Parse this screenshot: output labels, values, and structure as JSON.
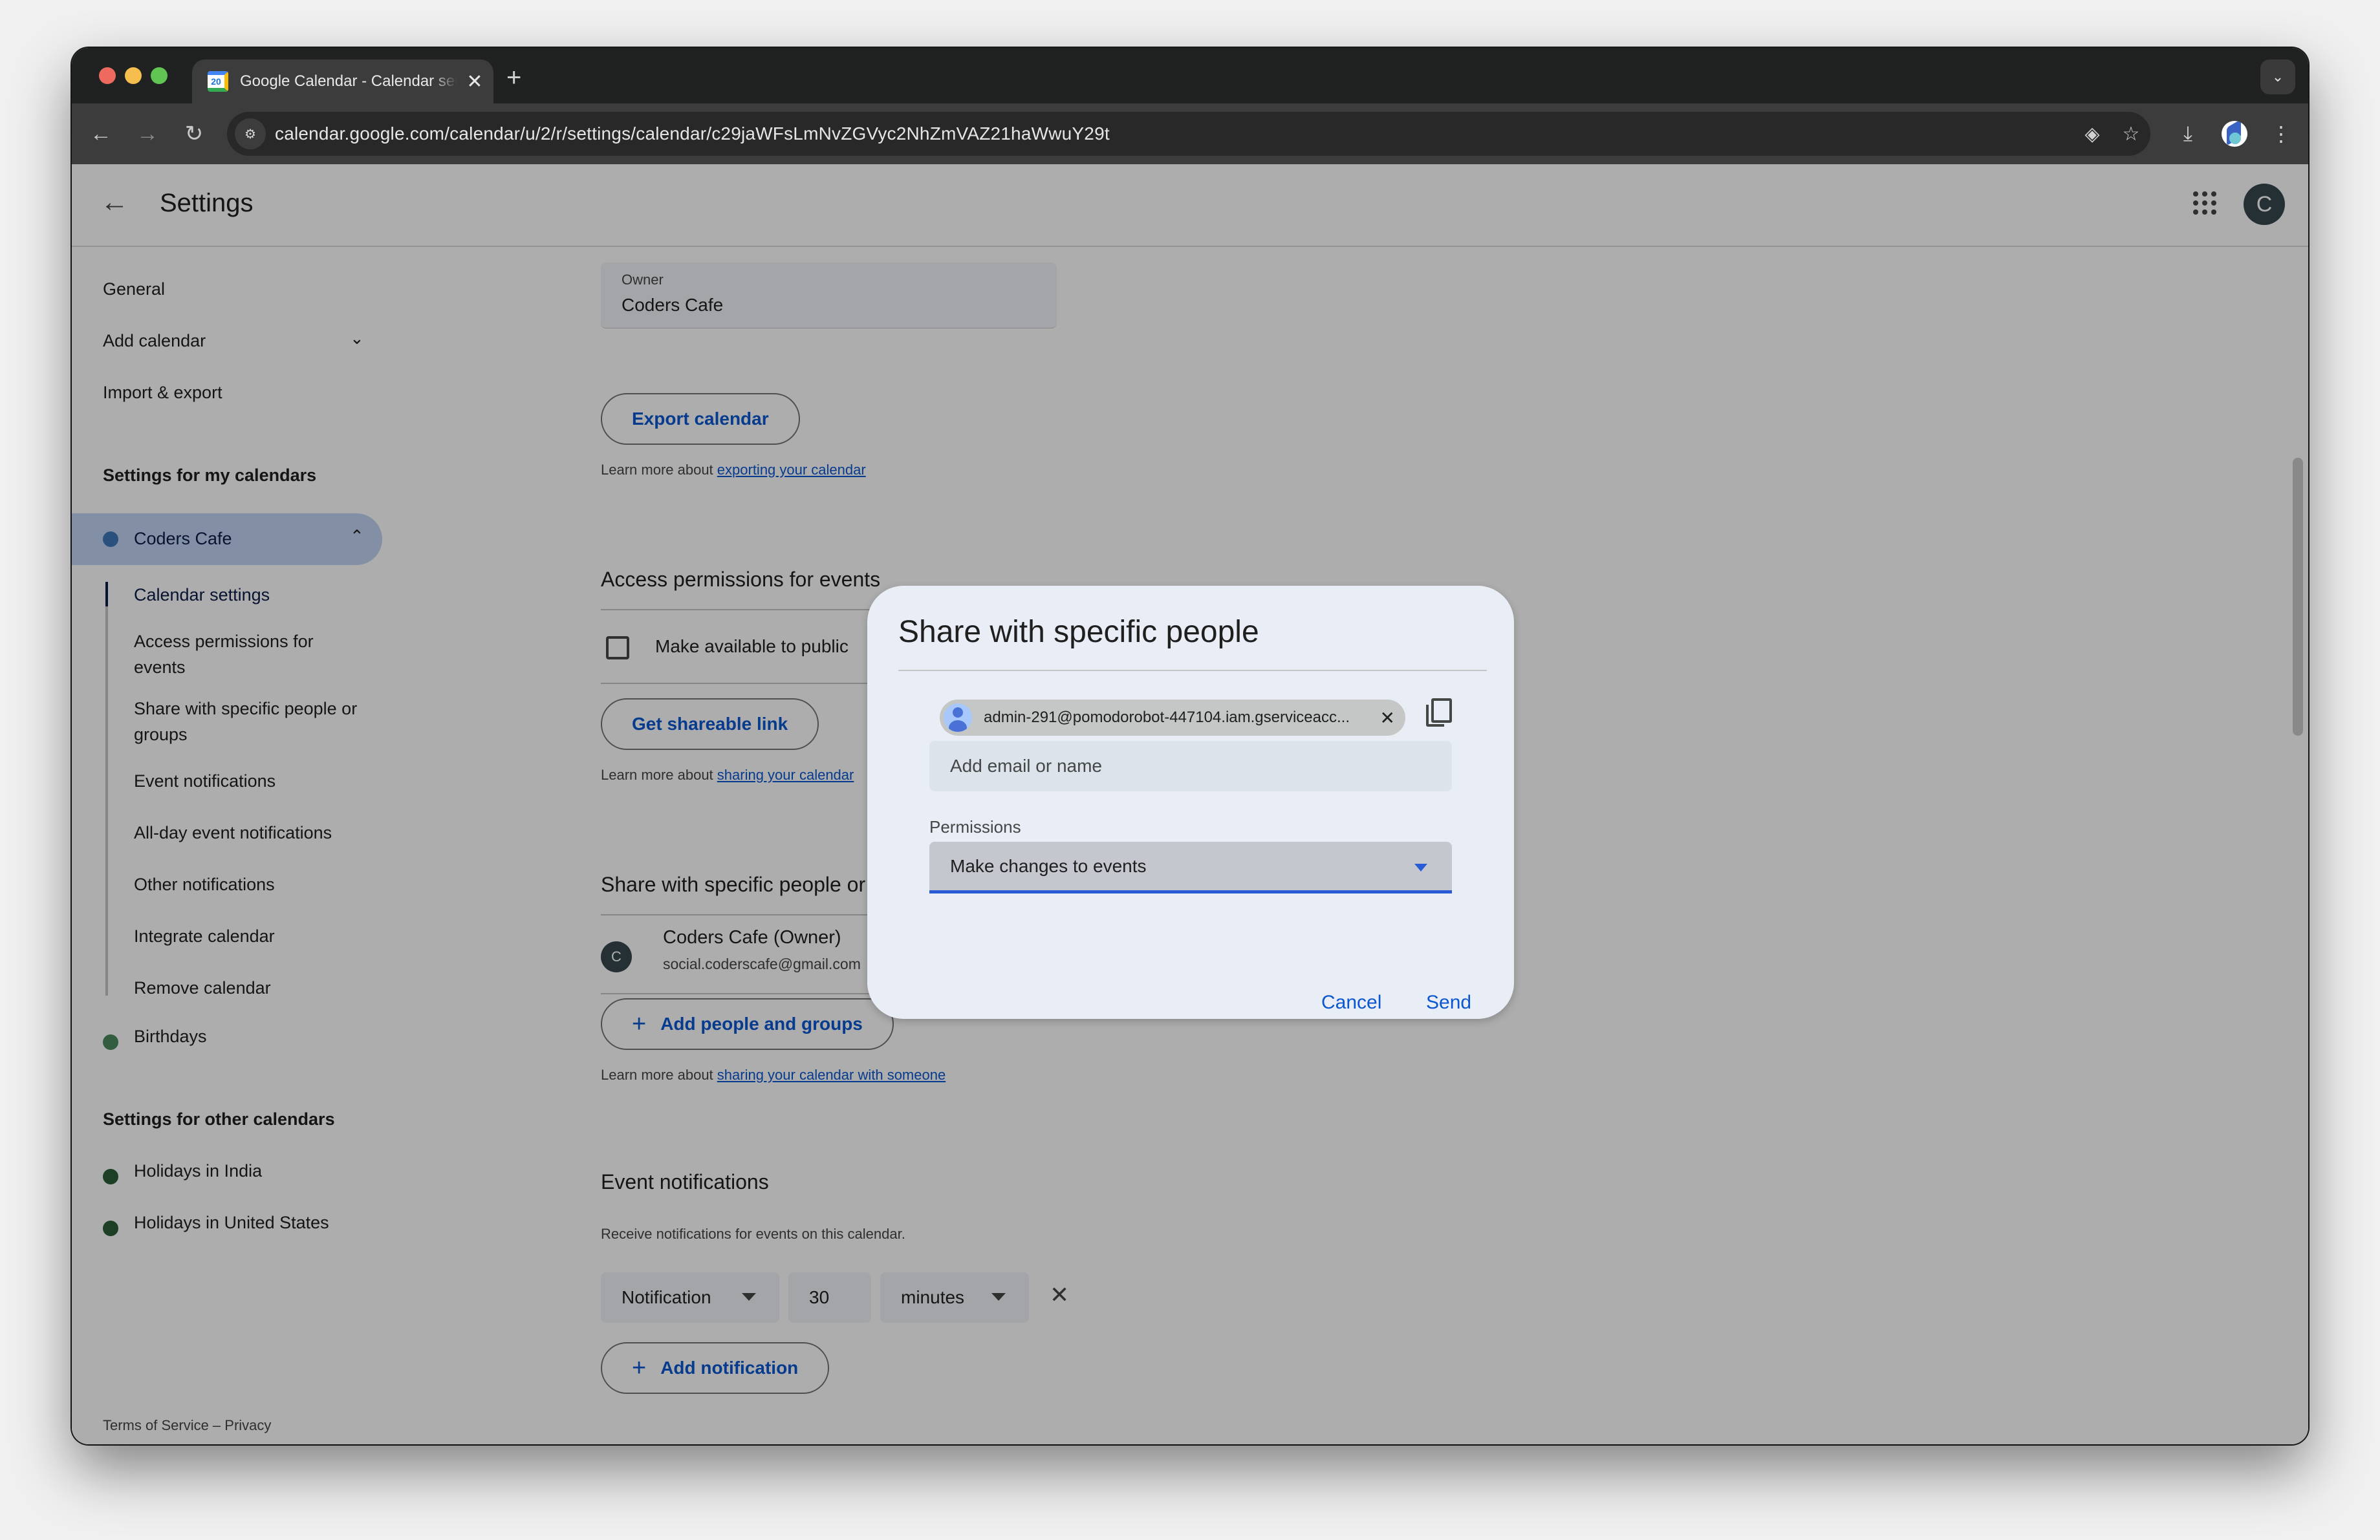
{
  "browser": {
    "tab_title": "Google Calendar - Calendar settings",
    "favicon_text": "20",
    "url": "calendar.google.com/calendar/u/2/r/settings/calendar/c29jaWFsLmNvZGVyc2NhZmVAZ21haWwuY29t",
    "icons": {
      "back": "←",
      "forward": "→",
      "reload": "↻",
      "new_tab": "+",
      "tab_close": "✕",
      "tab_search": "⌄",
      "site_info": "⚙",
      "lens": "◈",
      "bookmark": "☆",
      "download": "⤓",
      "menu": "⋮"
    }
  },
  "header": {
    "back_icon": "←",
    "title": "Settings",
    "avatar_letter": "C"
  },
  "sidebar": {
    "top_items": [
      {
        "label": "General"
      },
      {
        "label": "Add calendar",
        "caret": "⌄"
      },
      {
        "label": "Import & export"
      }
    ],
    "my_calendars_heading": "Settings for my calendars",
    "active_calendar": {
      "label": "Coders Cafe",
      "color": "#3f78b8",
      "caret": "⌃"
    },
    "sub_items": [
      {
        "label": "Calendar settings",
        "active": true
      },
      {
        "label": "Access permissions for events"
      },
      {
        "label": "Share with specific people or groups"
      },
      {
        "label": "Event notifications"
      },
      {
        "label": "All-day event notifications"
      },
      {
        "label": "Other notifications"
      },
      {
        "label": "Integrate calendar"
      },
      {
        "label": "Remove calendar"
      }
    ],
    "birthdays": {
      "label": "Birthdays",
      "color": "#4a8a5e"
    },
    "other_calendars_heading": "Settings for other calendars",
    "other_calendars": [
      {
        "label": "Holidays in India",
        "color": "#2a5e37"
      },
      {
        "label": "Holidays in United States",
        "color": "#2a5e37"
      }
    ],
    "footer": "Terms of Service – Privacy"
  },
  "content": {
    "owner": {
      "label": "Owner",
      "value": "Coders Cafe"
    },
    "export_button": "Export calendar",
    "export_help": {
      "prefix": "Learn more about ",
      "link": "exporting your calendar"
    },
    "access": {
      "title": "Access permissions for events",
      "public_checkbox_label": "Make available to public",
      "public_checked": false,
      "shareable_link_button": "Get shareable link",
      "help": {
        "prefix": "Learn more about ",
        "link": "sharing your calendar"
      }
    },
    "share": {
      "title": "Share with specific people or groups",
      "people": [
        {
          "avatar": "C",
          "name": "Coders Cafe (Owner)",
          "email": "social.coderscafe@gmail.com"
        }
      ],
      "add_button": "Add people and groups",
      "help": {
        "prefix": "Learn more about ",
        "link": "sharing your calendar with someone"
      }
    },
    "event_notifications": {
      "title": "Event notifications",
      "description": "Receive notifications for events on this calendar.",
      "rows": [
        {
          "type": "Notification",
          "amount": "30",
          "unit": "minutes"
        }
      ],
      "remove_icon": "✕",
      "add_button": "Add notification"
    }
  },
  "dialog": {
    "title": "Share with specific people",
    "chips": [
      {
        "email": "admin-291@pomodorobot-447104.iam.gserviceacc..."
      }
    ],
    "chip_remove_icon": "✕",
    "input_placeholder": "Add email or name",
    "input_value": "",
    "permissions_label": "Permissions",
    "permissions_value": "Make changes to events",
    "cancel_label": "Cancel",
    "send_label": "Send"
  }
}
